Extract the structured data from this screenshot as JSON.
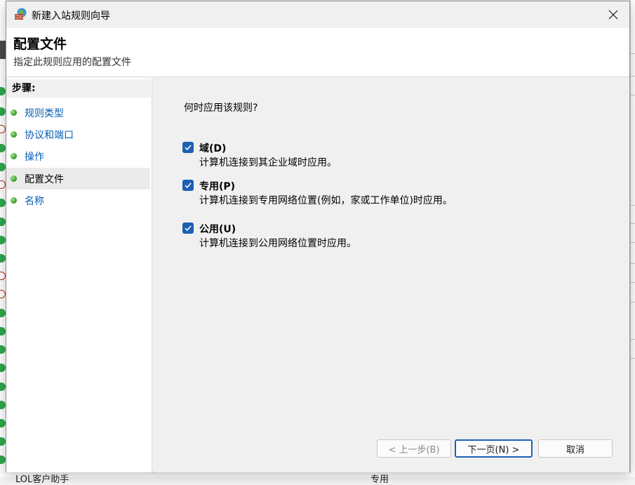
{
  "window": {
    "title": "新建入站规则向导",
    "close_symbol": "✕"
  },
  "header": {
    "title": "配置文件",
    "subtitle": "指定此规则应用的配置文件"
  },
  "steps": {
    "heading": "步骤:",
    "items": [
      {
        "label": "规则类型"
      },
      {
        "label": "协议和端口"
      },
      {
        "label": "操作"
      },
      {
        "label": "配置文件"
      },
      {
        "label": "名称"
      }
    ]
  },
  "main": {
    "question": "何时应用该规则?",
    "options": [
      {
        "title": "域(D)",
        "desc": "计算机连接到其企业域时应用。",
        "checked": true
      },
      {
        "title": "专用(P)",
        "desc": "计算机连接到专用网络位置(例如，家或工作单位)时应用。",
        "checked": true
      },
      {
        "title": "公用(U)",
        "desc": "计算机连接到公用网络位置时应用。",
        "checked": true
      }
    ]
  },
  "buttons": {
    "back": "< 上一步(B)",
    "next": "下一页(N) >",
    "cancel": "取消"
  },
  "background": {
    "bottom_left_text": "LOL客户助手",
    "bottom_right_text": "专用"
  }
}
